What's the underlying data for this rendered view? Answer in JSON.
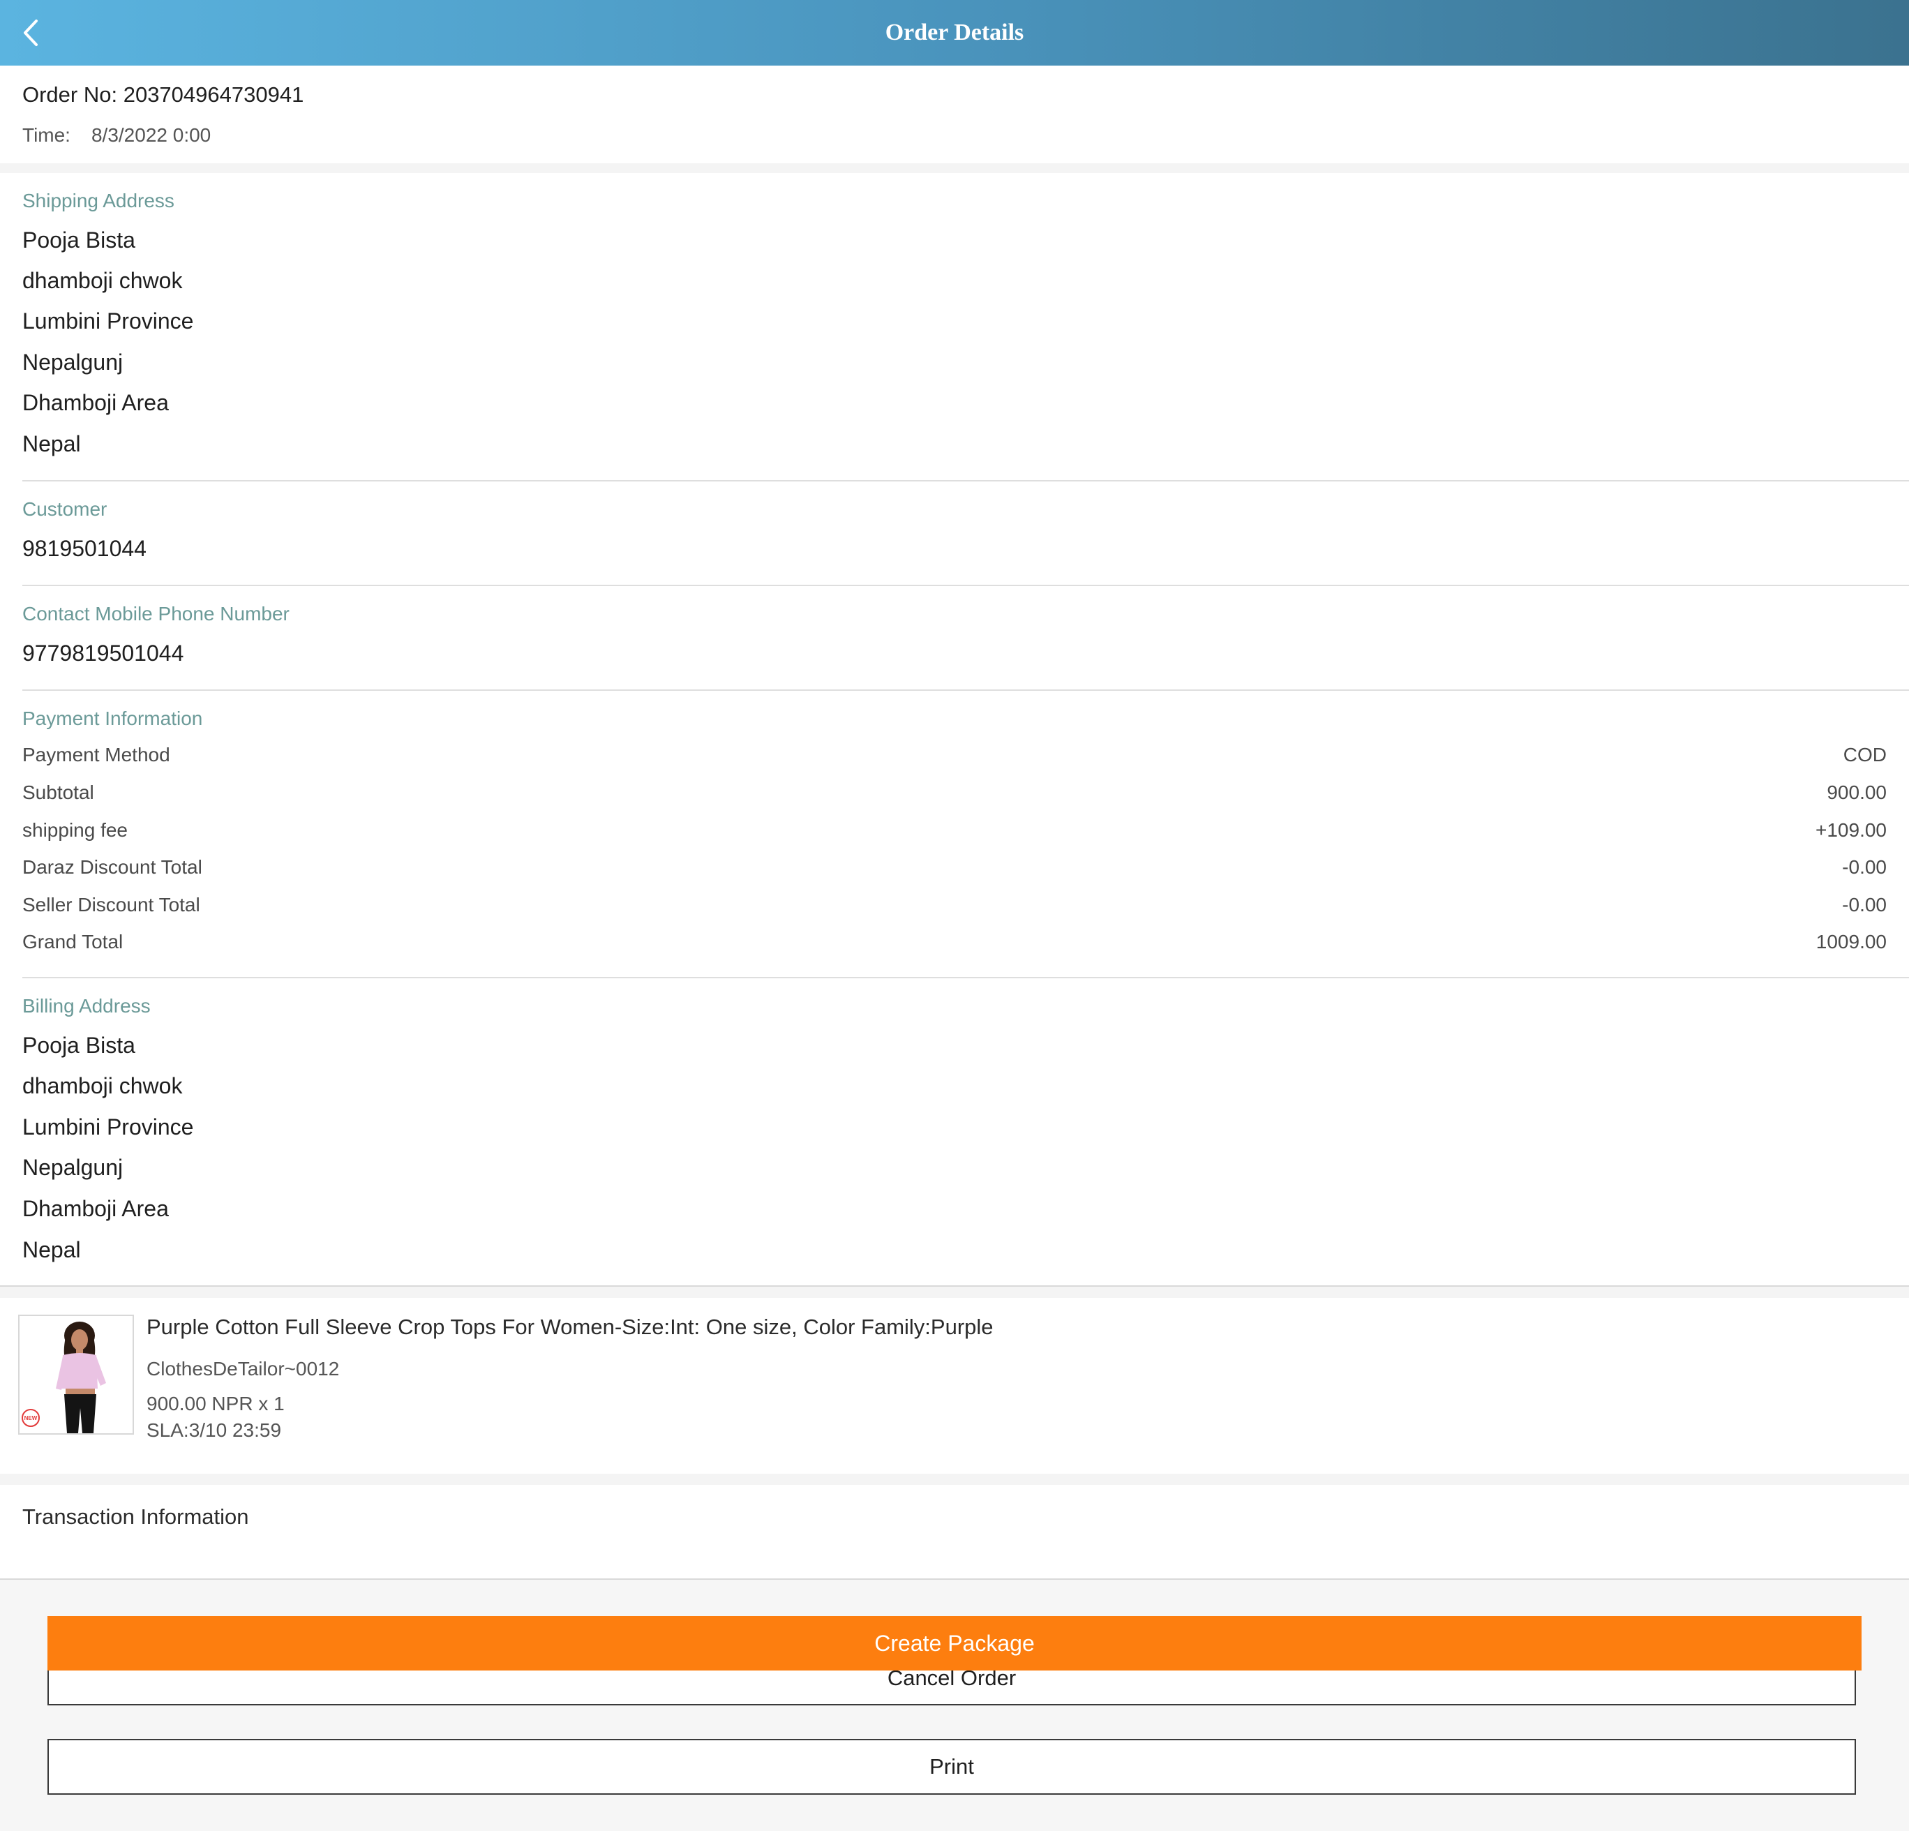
{
  "header": {
    "title": "Order Details",
    "background_gradient": [
      "#5bb4e0",
      "#4a94bd",
      "#3b728f"
    ],
    "back_icon": "chevron-left-icon"
  },
  "order": {
    "number_label": "Order No: 203704964730941",
    "time_label": "Time:",
    "time_value": "8/3/2022 0:00"
  },
  "shipping": {
    "label": "Shipping Address",
    "lines": [
      "Pooja Bista",
      "dhamboji chwok",
      "Lumbini Province",
      "Nepalgunj",
      "Dhamboji Area",
      "Nepal"
    ]
  },
  "customer": {
    "label": "Customer",
    "value": "9819501044"
  },
  "contact": {
    "label": "Contact Mobile Phone Number",
    "value": "9779819501044"
  },
  "payment": {
    "label": "Payment Information",
    "rows": [
      {
        "label": "Payment Method",
        "value": "COD"
      },
      {
        "label": "Subtotal",
        "value": "900.00"
      },
      {
        "label": "shipping fee",
        "value": "+109.00"
      },
      {
        "label": "Daraz Discount Total",
        "value": "-0.00"
      },
      {
        "label": "Seller Discount Total",
        "value": "-0.00"
      },
      {
        "label": "Grand Total",
        "value": "1009.00"
      }
    ]
  },
  "billing": {
    "label": "Billing Address",
    "lines": [
      "Pooja Bista",
      "dhamboji chwok",
      "Lumbini Province",
      "Nepalgunj",
      "Dhamboji Area",
      "Nepal"
    ]
  },
  "product": {
    "title": "Purple Cotton Full Sleeve Crop Tops For Women-Size:Int: One size, Color Family:Purple",
    "seller_sku": "ClothesDeTailor~0012",
    "price_qty": "900.00 NPR x 1",
    "sla": "SLA:3/10 23:59",
    "thumbnail_icon": "product-photo-icon",
    "badge_text": "NEW"
  },
  "transaction": {
    "title": "Transaction Information"
  },
  "actions": {
    "create_package": "Create Package",
    "cancel_order": "Cancel Order",
    "print": "Print",
    "primary_color": "#fd7e0f"
  }
}
